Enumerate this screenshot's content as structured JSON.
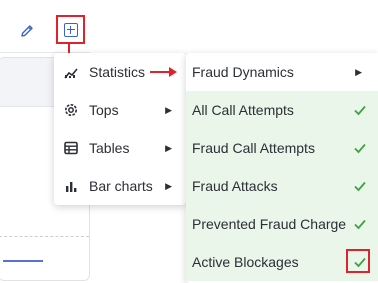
{
  "toolbar": {
    "edit_icon": "pencil-icon",
    "add_icon": "add-widget-icon"
  },
  "menu": {
    "items": [
      {
        "label": "Statistics",
        "icon": "chart-trend-icon"
      },
      {
        "label": "Tops",
        "icon": "gear-icon"
      },
      {
        "label": "Tables",
        "icon": "table-icon"
      },
      {
        "label": "Bar charts",
        "icon": "bar-chart-icon"
      }
    ]
  },
  "submenu": {
    "items": [
      {
        "label": "Fraud Dynamics",
        "checked": false
      },
      {
        "label": "All Call Attempts",
        "checked": true
      },
      {
        "label": "Fraud Call Attempts",
        "checked": true
      },
      {
        "label": "Fraud Attacks",
        "checked": true
      },
      {
        "label": "Prevented Fraud Charge",
        "checked": true
      },
      {
        "label": "Active Blockages",
        "checked": true
      }
    ]
  },
  "colors": {
    "accent": "#3b63c9",
    "highlight": "#e0232b",
    "check": "#43a047",
    "checked_bg": "#eaf6ea"
  }
}
